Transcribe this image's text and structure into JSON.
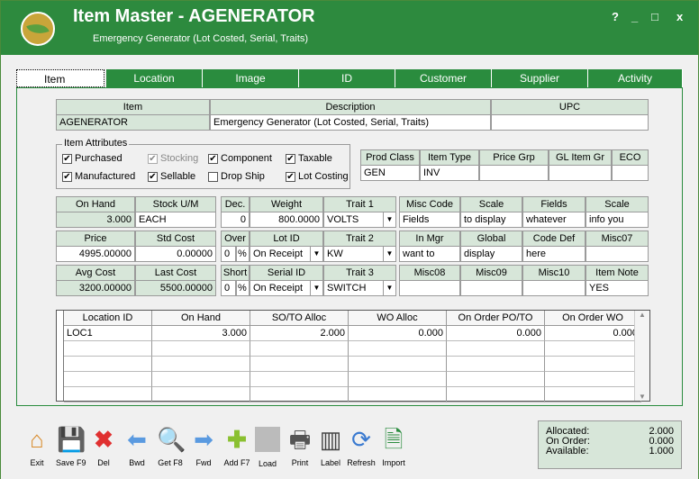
{
  "title": {
    "main": "Item Master - AGENERATOR",
    "sub": "Emergency Generator (Lot Costed, Serial, Traits)",
    "help": "?",
    "min": "_",
    "max": "□",
    "close": "x"
  },
  "tabs": [
    "Item",
    "Location",
    "Image",
    "ID",
    "Customer",
    "Supplier",
    "Activity"
  ],
  "header": {
    "item_h": "Item",
    "desc_h": "Description",
    "upc_h": "UPC",
    "item": "AGENERATOR",
    "desc": "Emergency Generator (Lot Costed, Serial, Traits)",
    "upc": ""
  },
  "attrs": {
    "legend": "Item Attributes",
    "purchased": "Purchased",
    "stocking": "Stocking",
    "component": "Component",
    "taxable": "Taxable",
    "manufactured": "Manufactured",
    "sellable": "Sellable",
    "dropship": "Drop Ship",
    "lotcosting": "Lot Costing"
  },
  "prod": {
    "h1": "Prod Class",
    "h2": "Item Type",
    "h3": "Price Grp",
    "h4": "GL Item Gr",
    "h5": "ECO",
    "v1": "GEN",
    "v2": "INV",
    "v3": "",
    "v4": "",
    "v5": ""
  },
  "stock": {
    "onhand_h": "On Hand",
    "stockum_h": "Stock U/M",
    "onhand": "3.000",
    "stockum": "EACH",
    "price_h": "Price",
    "stdcost_h": "Std Cost",
    "price": "4995.00000",
    "stdcost": "0.00000",
    "avg_h": "Avg Cost",
    "last_h": "Last Cost",
    "avg": "3200.00000",
    "last": "5500.00000"
  },
  "mid": {
    "dec_h": "Dec.",
    "weight_h": "Weight",
    "trait1_h": "Trait 1",
    "dec": "0",
    "weight": "800.0000",
    "trait1": "VOLTS",
    "over_h": "Over",
    "lotid_h": "Lot ID",
    "trait2_h": "Trait 2",
    "over": "0",
    "pct": "%",
    "lotid": "On Receipt",
    "trait2": "KW",
    "short_h": "Short",
    "serial_h": "Serial ID",
    "trait3_h": "Trait 3",
    "short": "0",
    "serial": "On Receipt",
    "trait3": "SWITCH"
  },
  "misc": {
    "h_misccode": "Misc Code",
    "h_scale": "Scale",
    "h_fields": "Fields",
    "h_scale2": "Scale",
    "v_misccode": "Fields",
    "v_scale": "to display",
    "v_fields": "whatever",
    "v_scale2": "info you",
    "h_inmgr": "In Mgr",
    "h_global": "Global",
    "h_codedef": "Code Def",
    "h_misc07": "Misc07",
    "v_inmgr": "want to",
    "v_global": "display",
    "v_codedef": "here",
    "v_misc07": "",
    "h_misc08": "Misc08",
    "h_misc09": "Misc09",
    "h_misc10": "Misc10",
    "h_itemnote": "Item Note",
    "v_itemnote": "YES"
  },
  "loc_table": {
    "headers": [
      "Location ID",
      "On Hand",
      "SO/TO Alloc",
      "WO Alloc",
      "On Order PO/TO",
      "On Order WO"
    ],
    "rows": [
      [
        "LOC1",
        "3.000",
        "2.000",
        "0.000",
        "0.000",
        "0.000"
      ]
    ]
  },
  "toolbar": [
    "Exit",
    "Save F9",
    "Del",
    "Bwd",
    "Get F8",
    "Fwd",
    "Add F7",
    "Load",
    "Print",
    "Label",
    "Refresh",
    "Import"
  ],
  "summary": {
    "alloc_l": "Allocated:",
    "alloc": "2.000",
    "order_l": "On Order:",
    "order": "0.000",
    "avail_l": "Available:",
    "avail": "1.000"
  }
}
